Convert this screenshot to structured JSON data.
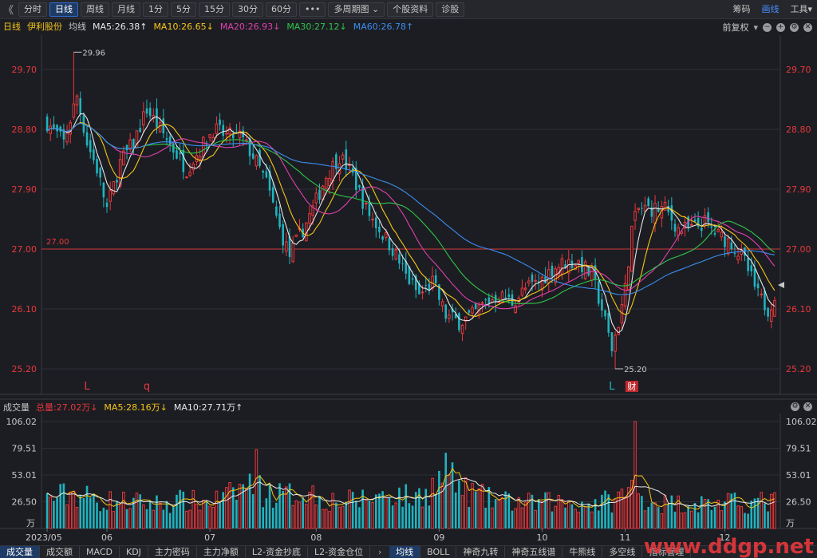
{
  "toolbar": {
    "back": "《",
    "periods": [
      "分时",
      "日线",
      "周线",
      "月线",
      "1分",
      "5分",
      "15分",
      "30分",
      "60分",
      "•••",
      "多周期图 ⌄",
      "个股资料",
      "诊股"
    ],
    "active_index": 1,
    "right": [
      "筹码",
      "画线",
      "工具▾"
    ],
    "right_active_index": 1
  },
  "info": {
    "period": "日线",
    "stock": "伊利股份",
    "ma_label": "均线",
    "ma": [
      {
        "text": "MA5:26.38↑",
        "color": "#e8e8e8"
      },
      {
        "text": "MA10:26.65↓",
        "color": "#f5c518"
      },
      {
        "text": "MA20:26.93↓",
        "color": "#e040b0"
      },
      {
        "text": "MA30:27.12↓",
        "color": "#2fc64a"
      },
      {
        "text": "MA60:26.78↑",
        "color": "#3a8df0"
      }
    ],
    "adjust": "前复权"
  },
  "volume_info": {
    "label": "成交量",
    "total": "总量:27.02万↓",
    "ma5": "MA5:28.16万↓",
    "ma10": "MA10:27.71万↑"
  },
  "colors": {
    "up": "#e8383d",
    "down": "#1fb4c0",
    "ma5": "#e8e8e8",
    "ma10": "#f5c518",
    "ma20": "#e040b0",
    "ma30": "#2fc64a",
    "ma60": "#3a8df0",
    "refline": "#d0393c"
  },
  "chart_data": {
    "type": "candlestick",
    "price_ticks": [
      "29.70",
      "28.80",
      "27.90",
      "27.00",
      "26.10",
      "25.20"
    ],
    "price_range": [
      25.2,
      29.7
    ],
    "reference_line": {
      "value": 27.0,
      "label": "27.00"
    },
    "high_mark": "29.96",
    "low_mark": "25.20",
    "markers": [
      "L",
      "q",
      "L",
      "财"
    ],
    "volume_ticks": [
      "106.02",
      "79.51",
      "53.01",
      "26.50"
    ],
    "volume_unit": "万",
    "volume_range": [
      0,
      106.02
    ],
    "x_labels": [
      "2023/05",
      "06",
      "07",
      "08",
      "09",
      "10",
      "11",
      "12"
    ],
    "x_label_positions": [
      0,
      18,
      49,
      81,
      118,
      149,
      174,
      204
    ],
    "key_closes": [
      [
        0,
        28.9
      ],
      [
        5,
        28.6
      ],
      [
        9,
        29.3
      ],
      [
        12,
        28.6
      ],
      [
        15,
        28.2
      ],
      [
        18,
        27.6
      ],
      [
        22,
        28.3
      ],
      [
        26,
        28.6
      ],
      [
        30,
        29.1
      ],
      [
        34,
        28.8
      ],
      [
        38,
        28.5
      ],
      [
        42,
        28.2
      ],
      [
        46,
        28.5
      ],
      [
        50,
        28.8
      ],
      [
        54,
        28.7
      ],
      [
        58,
        28.7
      ],
      [
        62,
        28.4
      ],
      [
        66,
        28.0
      ],
      [
        70,
        27.3
      ],
      [
        73,
        26.9
      ],
      [
        76,
        27.2
      ],
      [
        80,
        27.6
      ],
      [
        84,
        28.1
      ],
      [
        88,
        28.4
      ],
      [
        92,
        28.1
      ],
      [
        96,
        27.6
      ],
      [
        100,
        27.3
      ],
      [
        104,
        27.0
      ],
      [
        108,
        26.6
      ],
      [
        112,
        26.3
      ],
      [
        116,
        26.5
      ],
      [
        120,
        26.0
      ],
      [
        124,
        25.9
      ],
      [
        128,
        26.0
      ],
      [
        132,
        26.2
      ],
      [
        136,
        26.3
      ],
      [
        140,
        26.2
      ],
      [
        144,
        26.4
      ],
      [
        148,
        26.5
      ],
      [
        152,
        26.7
      ],
      [
        156,
        26.8
      ],
      [
        160,
        26.8
      ],
      [
        164,
        26.6
      ],
      [
        167,
        26.1
      ],
      [
        170,
        25.5
      ],
      [
        172,
        25.9
      ],
      [
        174,
        26.4
      ],
      [
        176,
        27.3
      ],
      [
        178,
        27.6
      ],
      [
        182,
        27.6
      ],
      [
        186,
        27.6
      ],
      [
        190,
        27.3
      ],
      [
        194,
        27.3
      ],
      [
        198,
        27.4
      ],
      [
        202,
        27.2
      ],
      [
        206,
        27.1
      ],
      [
        210,
        26.8
      ],
      [
        214,
        26.3
      ],
      [
        217,
        26.1
      ],
      [
        219,
        26.3
      ]
    ],
    "volume_keys": [
      [
        0,
        30
      ],
      [
        8,
        36
      ],
      [
        16,
        28
      ],
      [
        24,
        27
      ],
      [
        32,
        25
      ],
      [
        40,
        28
      ],
      [
        48,
        26
      ],
      [
        55,
        33
      ],
      [
        60,
        45
      ],
      [
        66,
        36
      ],
      [
        72,
        33
      ],
      [
        78,
        38
      ],
      [
        84,
        29
      ],
      [
        90,
        27
      ],
      [
        98,
        32
      ],
      [
        104,
        36
      ],
      [
        110,
        30
      ],
      [
        116,
        42
      ],
      [
        120,
        52
      ],
      [
        126,
        38
      ],
      [
        132,
        30
      ],
      [
        140,
        27
      ],
      [
        146,
        25
      ],
      [
        152,
        27
      ],
      [
        158,
        26
      ],
      [
        164,
        25
      ],
      [
        172,
        30
      ],
      [
        176,
        42
      ],
      [
        180,
        30
      ],
      [
        186,
        25
      ],
      [
        194,
        26
      ],
      [
        202,
        25
      ],
      [
        210,
        26
      ],
      [
        219,
        27
      ]
    ]
  },
  "bottom_tabs_left": [
    "成交量",
    "成交额",
    "MACD",
    "KDJ",
    "主力密码",
    "主力净额",
    "L2-资金抄底",
    "L2-资金仓位"
  ],
  "bottom_tabs_right": [
    "均线",
    "BOLL",
    "神奇九转",
    "神奇五线谱",
    "牛熊线",
    "多空线",
    "指标管理"
  ],
  "bottom_nav": "›",
  "watermark": "www.ddgp.net"
}
